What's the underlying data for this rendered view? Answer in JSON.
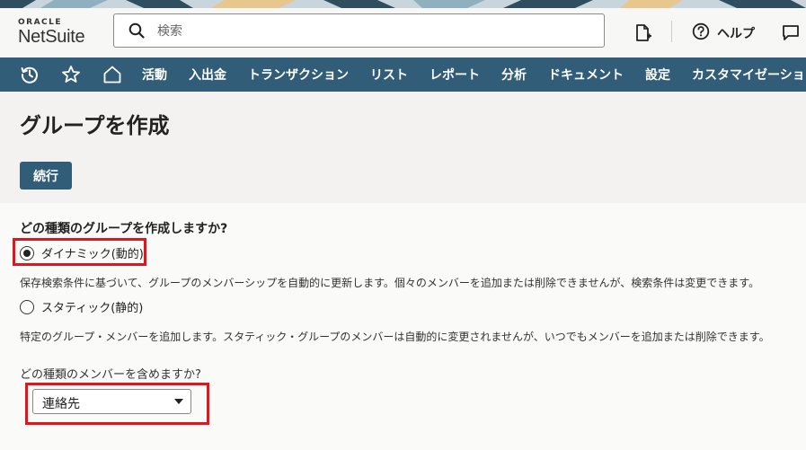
{
  "header": {
    "logo_oracle": "ORACLE",
    "logo_netsuite": "NetSuite",
    "search_placeholder": "検索",
    "help_label": "ヘルプ"
  },
  "nav": {
    "items": [
      "活動",
      "入出金",
      "トランザクション",
      "リスト",
      "レポート",
      "分析",
      "ドキュメント",
      "設定",
      "カスタマイゼーション"
    ]
  },
  "page": {
    "title": "グループを作成",
    "continue_label": "続行",
    "question": "どの種類のグループを作成しますか?",
    "dynamic_label": "ダイナミック(動的)",
    "dynamic_desc": "保存検索条件に基づいて、グループのメンバーシップを自動的に更新します。個々のメンバーを追加または削除できませんが、検索条件は変更できます。",
    "static_label": "スタティック(静的)",
    "static_desc": "特定のグループ・メンバーを追加します。スタティック・グループのメンバーは自動的に変更されませんが、いつでもメンバーを追加または削除できます。",
    "member_question": "どの種類のメンバーを含めますか?",
    "member_value": "連絡先",
    "selected_type": "dynamic"
  },
  "colors": {
    "nav_bg": "#325d78",
    "button_bg": "#325d78",
    "highlight": "#e0161e"
  }
}
